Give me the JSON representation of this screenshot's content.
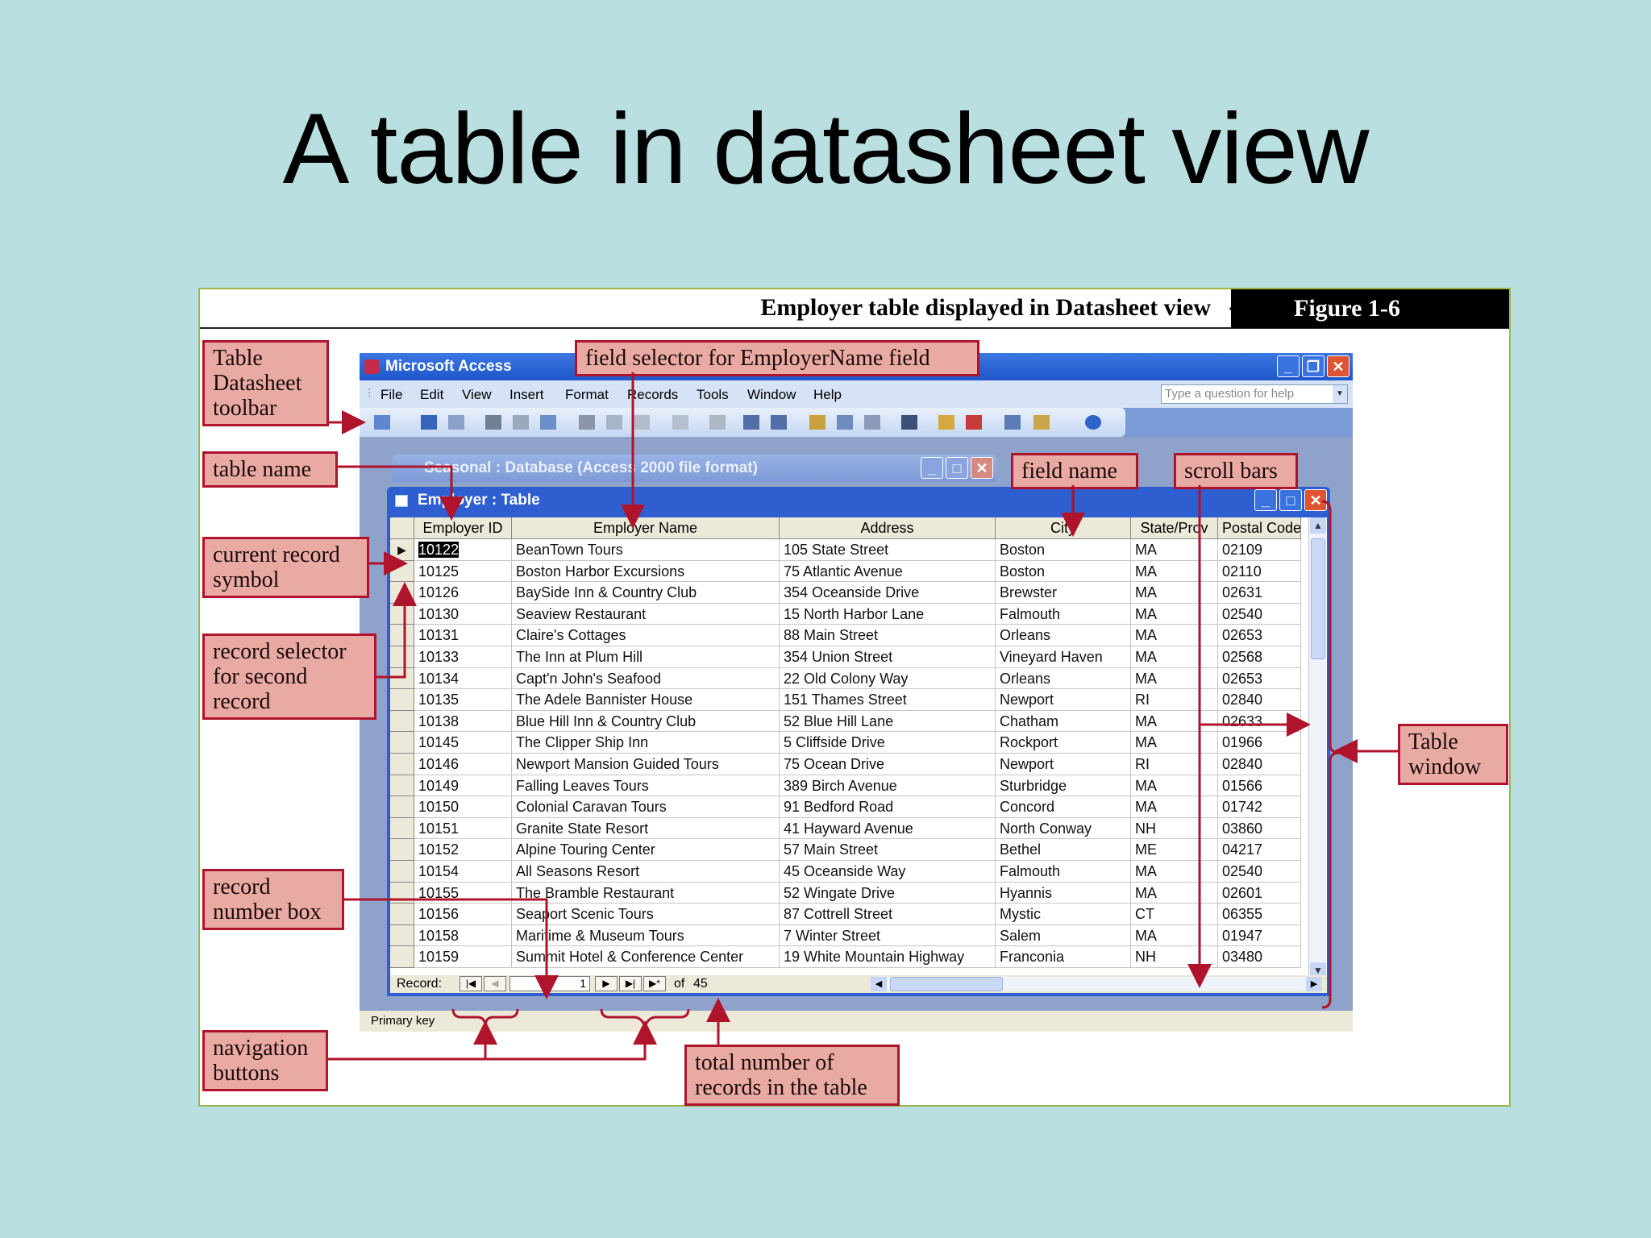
{
  "slide": {
    "title": "A table in datasheet view"
  },
  "figure": {
    "caption": "Employer table displayed in Datasheet view",
    "number": "Figure 1-6"
  },
  "callouts": {
    "toolbar": "Table\nDatasheet\ntoolbar",
    "table_name": "table name",
    "current_record": "current record\nsymbol",
    "record_selector": "record selector\nfor second\nrecord",
    "record_number_box": "record\nnumber box",
    "navigation_buttons": "navigation\nbuttons",
    "field_selector": "field selector for EmployerName field",
    "field_name": "field name",
    "scroll_bars": "scroll bars",
    "table_window": "Table\nwindow",
    "total_records": "total number of\nrecords in the table"
  },
  "app": {
    "title": "Microsoft Access",
    "menu": [
      "File",
      "Edit",
      "View",
      "Insert",
      "Format",
      "Records",
      "Tools",
      "Window",
      "Help"
    ],
    "help_placeholder": "Type a question for help",
    "db_title": "Seasonal : Database (Access 2000 file format)",
    "table_title": "Employer : Table",
    "status": "Primary key"
  },
  "table": {
    "columns": [
      "Employer ID",
      "Employer Name",
      "Address",
      "City",
      "State/Prov",
      "Postal Code"
    ],
    "rows": [
      [
        "10122",
        "BeanTown Tours",
        "105 State Street",
        "Boston",
        "MA",
        "02109"
      ],
      [
        "10125",
        "Boston Harbor Excursions",
        "75 Atlantic Avenue",
        "Boston",
        "MA",
        "02110"
      ],
      [
        "10126",
        "BaySide Inn & Country Club",
        "354 Oceanside Drive",
        "Brewster",
        "MA",
        "02631"
      ],
      [
        "10130",
        "Seaview Restaurant",
        "15 North Harbor Lane",
        "Falmouth",
        "MA",
        "02540"
      ],
      [
        "10131",
        "Claire's Cottages",
        "88 Main Street",
        "Orleans",
        "MA",
        "02653"
      ],
      [
        "10133",
        "The Inn at Plum Hill",
        "354 Union Street",
        "Vineyard Haven",
        "MA",
        "02568"
      ],
      [
        "10134",
        "Capt'n John's Seafood",
        "22 Old Colony Way",
        "Orleans",
        "MA",
        "02653"
      ],
      [
        "10135",
        "The Adele Bannister House",
        "151 Thames Street",
        "Newport",
        "RI",
        "02840"
      ],
      [
        "10138",
        "Blue Hill Inn & Country Club",
        "52 Blue Hill Lane",
        "Chatham",
        "MA",
        "02633"
      ],
      [
        "10145",
        "The Clipper Ship Inn",
        "5 Cliffside Drive",
        "Rockport",
        "MA",
        "01966"
      ],
      [
        "10146",
        "Newport Mansion Guided Tours",
        "75 Ocean Drive",
        "Newport",
        "RI",
        "02840"
      ],
      [
        "10149",
        "Falling Leaves Tours",
        "389 Birch Avenue",
        "Sturbridge",
        "MA",
        "01566"
      ],
      [
        "10150",
        "Colonial Caravan Tours",
        "91 Bedford Road",
        "Concord",
        "MA",
        "01742"
      ],
      [
        "10151",
        "Granite State Resort",
        "41 Hayward Avenue",
        "North Conway",
        "NH",
        "03860"
      ],
      [
        "10152",
        "Alpine Touring Center",
        "57 Main Street",
        "Bethel",
        "ME",
        "04217"
      ],
      [
        "10154",
        "All Seasons Resort",
        "45 Oceanside Way",
        "Falmouth",
        "MA",
        "02540"
      ],
      [
        "10155",
        "The Bramble Restaurant",
        "52 Wingate Drive",
        "Hyannis",
        "MA",
        "02601"
      ],
      [
        "10156",
        "Seaport Scenic Tours",
        "87 Cottrell Street",
        "Mystic",
        "CT",
        "06355"
      ],
      [
        "10158",
        "Maritime & Museum Tours",
        "7 Winter Street",
        "Salem",
        "MA",
        "01947"
      ],
      [
        "10159",
        "Summit Hotel & Conference Center",
        "19 White Mountain Highway",
        "Franconia",
        "NH",
        "03480"
      ]
    ]
  },
  "navigation": {
    "record_label": "Record:",
    "current_record": "1",
    "of_label": "of",
    "total": "45"
  },
  "colors": {
    "background": "#b9dfe1",
    "callout_fill": "#e8aaa2",
    "callout_border": "#b0132c",
    "titlebar": "#1f56c9"
  }
}
